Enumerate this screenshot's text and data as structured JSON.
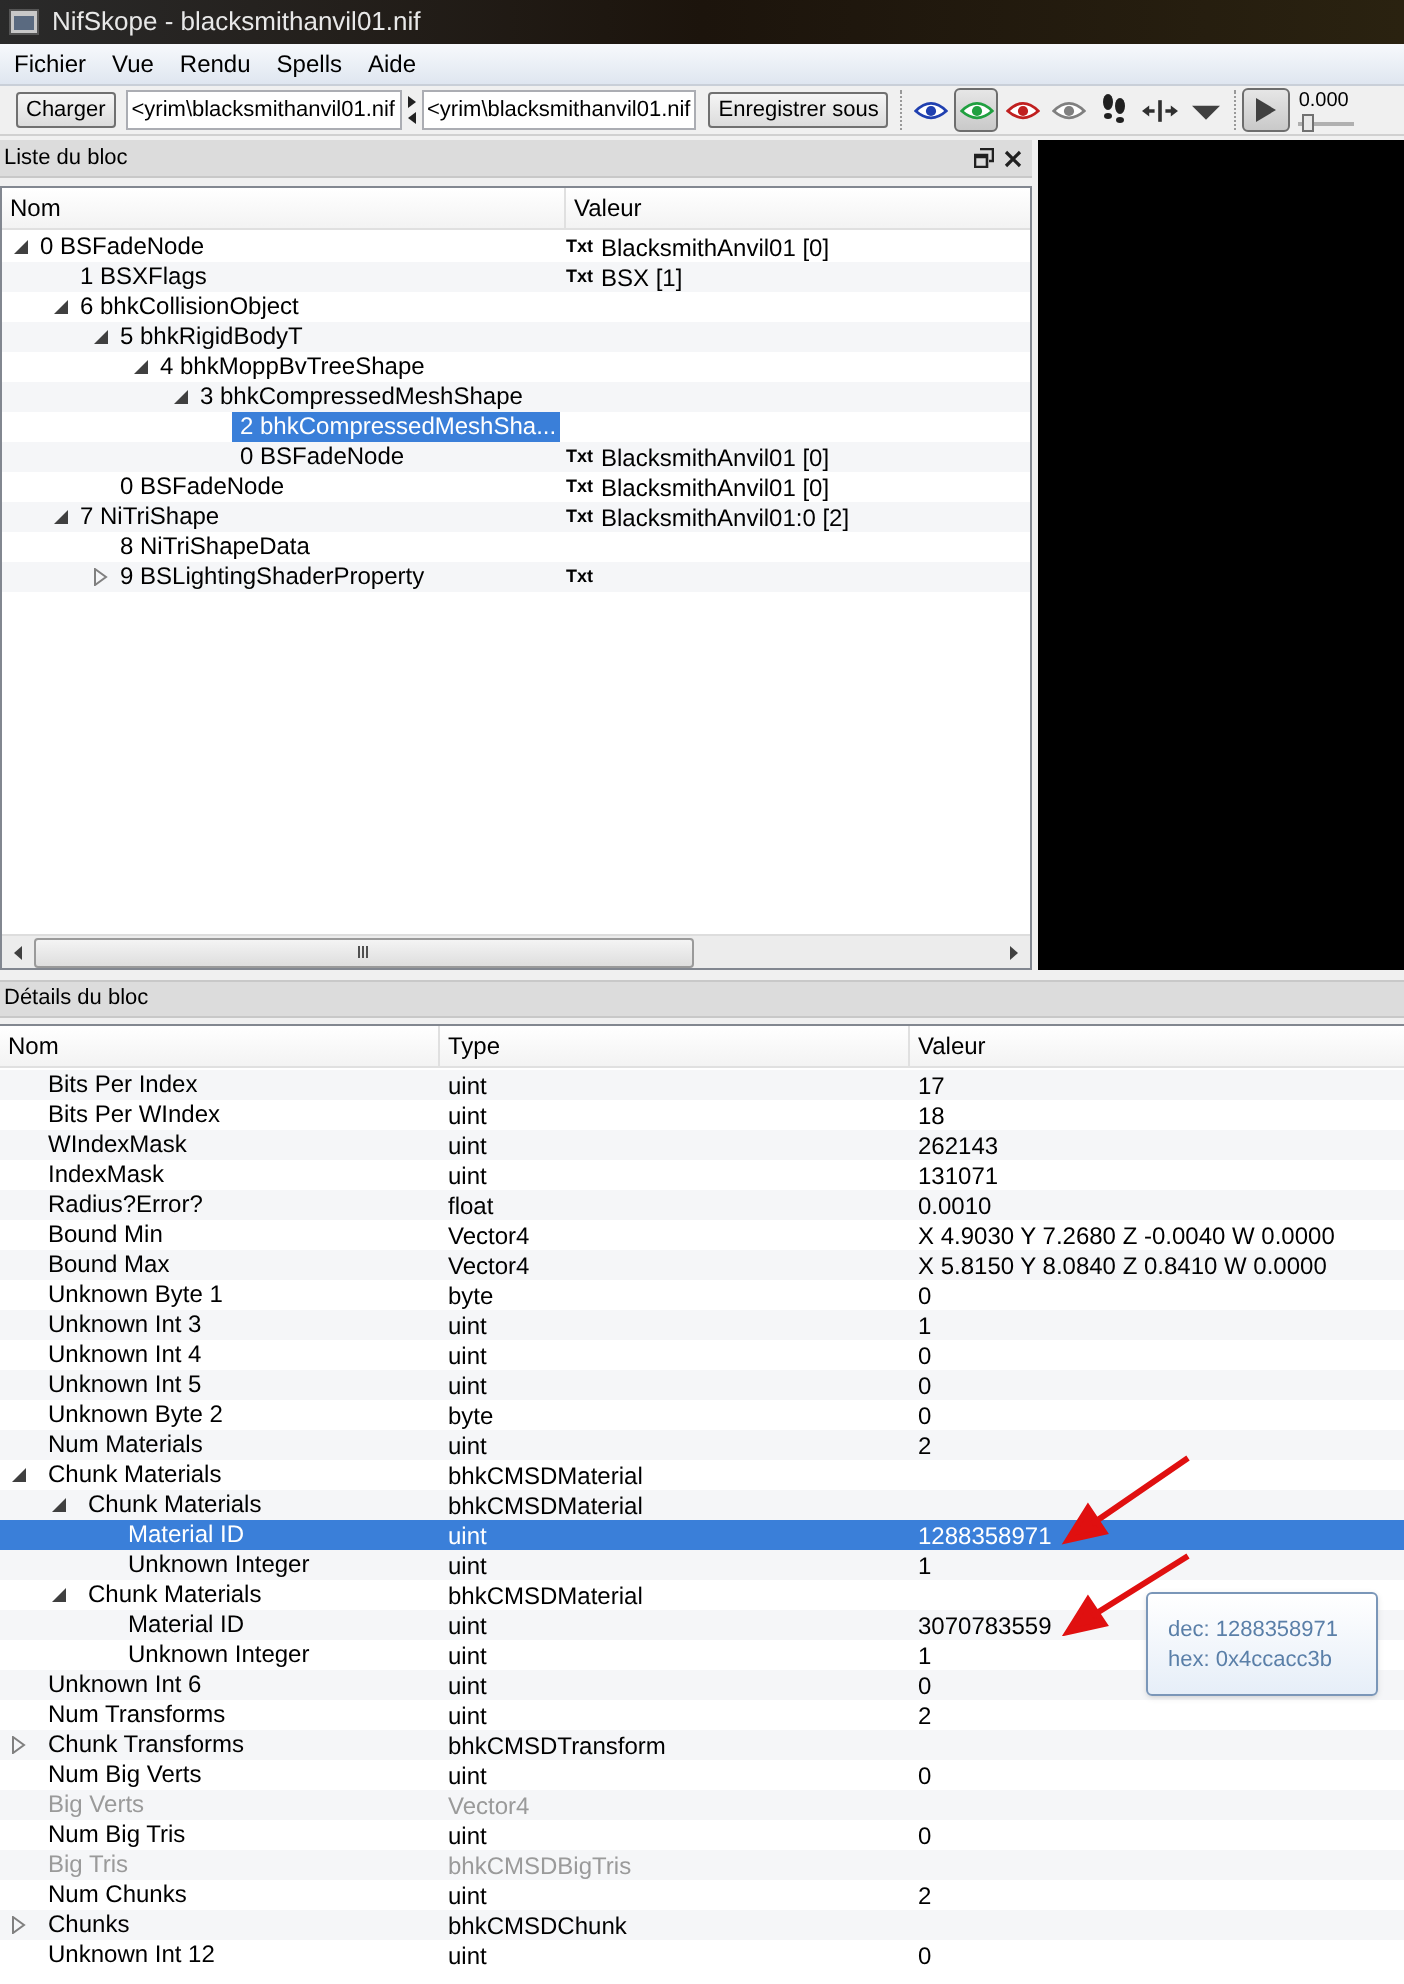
{
  "window": {
    "title": "NifSkope - blacksmithanvil01.nif"
  },
  "menu": [
    {
      "label": "Fichier"
    },
    {
      "label": "Vue"
    },
    {
      "label": "Rendu"
    },
    {
      "label": "Spells"
    },
    {
      "label": "Aide"
    }
  ],
  "toolbar": {
    "load_button": "Charger",
    "path_fields": [
      {
        "value": "<yrim\\blacksmithanvil01.nif"
      },
      {
        "value": "<yrim\\blacksmithanvil01.nif"
      }
    ],
    "save_button": "Enregistrer sous",
    "view_toggles": [
      {
        "kind": "eye",
        "color": "#2040b0",
        "on": false
      },
      {
        "kind": "eye",
        "color": "#20a040",
        "on": true
      },
      {
        "kind": "eye",
        "color": "#c02020",
        "on": false
      },
      {
        "kind": "eye",
        "color": "#808080",
        "on": false
      },
      {
        "kind": "footprints",
        "on": false
      }
    ],
    "play_on": true,
    "time": "0.000",
    "time_slider": {
      "level": 0.05
    }
  },
  "block_list": {
    "title": "Liste du bloc",
    "columns": [
      "Nom",
      "Valeur"
    ],
    "rows": [
      {
        "kind": "branch",
        "expanded": true,
        "selected": false,
        "name": "0 BSFadeNode",
        "tag": "Txt",
        "value": "BlacksmithAnvil01 [0]",
        "children": [
          {
            "kind": "leaf",
            "selected": false,
            "name": "1 BSXFlags",
            "tag": "Txt",
            "value": "BSX [1]"
          },
          {
            "kind": "branch",
            "expanded": true,
            "selected": false,
            "name": "6 bhkCollisionObject",
            "children": [
              {
                "kind": "branch",
                "expanded": true,
                "selected": false,
                "name": "5 bhkRigidBodyT",
                "children": [
                  {
                    "kind": "branch",
                    "expanded": true,
                    "selected": false,
                    "name": "4 bhkMoppBvTreeShape",
                    "children": [
                      {
                        "kind": "branch",
                        "expanded": true,
                        "selected": false,
                        "name": "3 bhkCompressedMeshShape",
                        "children": [
                          {
                            "kind": "leaf",
                            "selected": true,
                            "name": "2 bhkCompressedMeshSha..."
                          },
                          {
                            "kind": "leaf",
                            "selected": false,
                            "name": "0 BSFadeNode",
                            "tag": "Txt",
                            "value": "BlacksmithAnvil01 [0]"
                          }
                        ]
                      }
                    ]
                  }
                ]
              },
              {
                "kind": "leaf",
                "selected": false,
                "name": "0 BSFadeNode",
                "tag": "Txt",
                "value": "BlacksmithAnvil01 [0]"
              }
            ]
          },
          {
            "kind": "branch",
            "expanded": true,
            "selected": false,
            "name": "7 NiTriShape",
            "tag": "Txt",
            "value": "BlacksmithAnvil01:0 [2]",
            "children": [
              {
                "kind": "leaf",
                "selected": false,
                "name": "8 NiTriShapeData"
              },
              {
                "kind": "branch",
                "expanded": false,
                "selected": false,
                "name": "9 BSLightingShaderProperty",
                "tag": "Txt"
              }
            ]
          }
        ]
      }
    ]
  },
  "block_details": {
    "title": "Détails du bloc",
    "columns": [
      "Nom",
      "Type",
      "Valeur"
    ],
    "rows": [
      {
        "kind": "leaf",
        "name": "Bits Per Index",
        "type": "uint",
        "value": "17",
        "disabled": false,
        "selected": false
      },
      {
        "kind": "leaf",
        "name": "Bits Per WIndex",
        "type": "uint",
        "value": "18",
        "disabled": false,
        "selected": false
      },
      {
        "kind": "leaf",
        "name": "WIndexMask",
        "type": "uint",
        "value": "262143",
        "disabled": false,
        "selected": false
      },
      {
        "kind": "leaf",
        "name": "IndexMask",
        "type": "uint",
        "value": "131071",
        "disabled": false,
        "selected": false
      },
      {
        "kind": "leaf",
        "name": "Radius?Error?",
        "type": "float",
        "value": "0.0010",
        "disabled": false,
        "selected": false
      },
      {
        "kind": "leaf",
        "name": "Bound Min",
        "type": "Vector4",
        "value": "X 4.9030 Y 7.2680 Z -0.0040 W 0.0000",
        "disabled": false,
        "selected": false
      },
      {
        "kind": "leaf",
        "name": "Bound Max",
        "type": "Vector4",
        "value": "X 5.8150 Y 8.0840 Z 0.8410 W 0.0000",
        "disabled": false,
        "selected": false
      },
      {
        "kind": "leaf",
        "name": "Unknown Byte 1",
        "type": "byte",
        "value": "0",
        "disabled": false,
        "selected": false
      },
      {
        "kind": "leaf",
        "name": "Unknown Int 3",
        "type": "uint",
        "value": "1",
        "disabled": false,
        "selected": false
      },
      {
        "kind": "leaf",
        "name": "Unknown Int 4",
        "type": "uint",
        "value": "0",
        "disabled": false,
        "selected": false
      },
      {
        "kind": "leaf",
        "name": "Unknown Int 5",
        "type": "uint",
        "value": "0",
        "disabled": false,
        "selected": false
      },
      {
        "kind": "leaf",
        "name": "Unknown Byte 2",
        "type": "byte",
        "value": "0",
        "disabled": false,
        "selected": false
      },
      {
        "kind": "leaf",
        "name": "Num Materials",
        "type": "uint",
        "value": "2",
        "disabled": false,
        "selected": false
      },
      {
        "kind": "branch",
        "expanded": true,
        "name": "Chunk Materials",
        "type": "bhkCMSDMaterial",
        "disabled": false,
        "selected": false,
        "children": [
          {
            "kind": "branch",
            "expanded": true,
            "name": "Chunk Materials",
            "type": "bhkCMSDMaterial",
            "disabled": false,
            "selected": false,
            "children": [
              {
                "kind": "leaf",
                "name": "Material ID",
                "type": "uint",
                "value": "1288358971",
                "disabled": false,
                "selected": true
              },
              {
                "kind": "leaf",
                "name": "Unknown Integer",
                "type": "uint",
                "value": "1",
                "disabled": false,
                "selected": false
              }
            ]
          },
          {
            "kind": "branch",
            "expanded": true,
            "name": "Chunk Materials",
            "type": "bhkCMSDMaterial",
            "disabled": false,
            "selected": false,
            "children": [
              {
                "kind": "leaf",
                "name": "Material ID",
                "type": "uint",
                "value": "3070783559",
                "disabled": false,
                "selected": false
              },
              {
                "kind": "leaf",
                "name": "Unknown Integer",
                "type": "uint",
                "value": "1",
                "disabled": false,
                "selected": false
              }
            ]
          }
        ]
      },
      {
        "kind": "leaf",
        "name": "Unknown Int 6",
        "type": "uint",
        "value": "0",
        "disabled": false,
        "selected": false
      },
      {
        "kind": "leaf",
        "name": "Num Transforms",
        "type": "uint",
        "value": "2",
        "disabled": false,
        "selected": false
      },
      {
        "kind": "branch",
        "expanded": false,
        "name": "Chunk Transforms",
        "type": "bhkCMSDTransform",
        "disabled": false,
        "selected": false
      },
      {
        "kind": "leaf",
        "name": "Num Big Verts",
        "type": "uint",
        "value": "0",
        "disabled": false,
        "selected": false
      },
      {
        "kind": "leaf",
        "name": "Big Verts",
        "type": "Vector4",
        "disabled": true,
        "selected": false
      },
      {
        "kind": "leaf",
        "name": "Num Big Tris",
        "type": "uint",
        "value": "0",
        "disabled": false,
        "selected": false
      },
      {
        "kind": "leaf",
        "name": "Big Tris",
        "type": "bhkCMSDBigTris",
        "disabled": true,
        "selected": false
      },
      {
        "kind": "leaf",
        "name": "Num Chunks",
        "type": "uint",
        "value": "2",
        "disabled": false,
        "selected": false
      },
      {
        "kind": "branch",
        "expanded": false,
        "name": "Chunks",
        "type": "bhkCMSDChunk",
        "disabled": false,
        "selected": false
      },
      {
        "kind": "leaf",
        "name": "Unknown Int 12",
        "type": "uint",
        "value": "0",
        "disabled": false,
        "selected": false
      }
    ]
  },
  "tooltip": {
    "lines": [
      "dec: 1288358971",
      "hex: 0x4ccacc3b"
    ]
  }
}
